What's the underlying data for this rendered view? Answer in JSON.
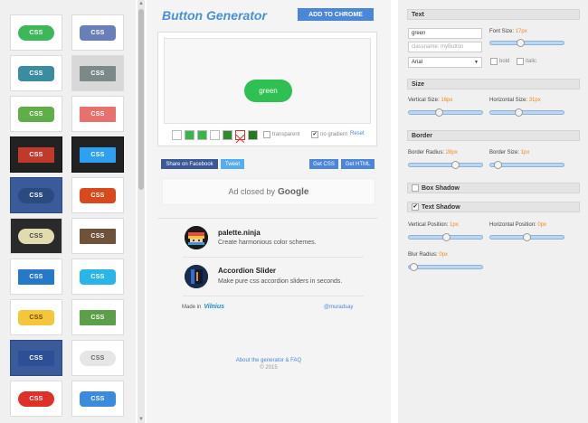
{
  "gallery": {
    "items": [
      {
        "label": "CSS",
        "color": "#3cb859",
        "shape": "pill",
        "bg": "plain"
      },
      {
        "label": "CSS",
        "color": "#6a7fba",
        "shape": "round",
        "bg": "plain"
      },
      {
        "label": "CSS",
        "color": "#3c8ca0",
        "shape": "round",
        "bg": "plain"
      },
      {
        "label": "CSS",
        "color": "#7b8a89",
        "shape": "flat",
        "bg": "grey"
      },
      {
        "label": "CSS",
        "color": "#5fae4a",
        "shape": "round",
        "bg": "plain"
      },
      {
        "label": "CSS",
        "color": "#e8716e",
        "shape": "flat",
        "bg": "plain"
      },
      {
        "label": "CSS",
        "color": "#c0392b",
        "shape": "flat",
        "bg": "dark"
      },
      {
        "label": "CSS",
        "color": "#2ea0f2",
        "shape": "flat",
        "bg": "dark"
      },
      {
        "label": "CSS",
        "color": "#2b4a80",
        "shape": "pill",
        "bg": "navy"
      },
      {
        "label": "CSS",
        "color": "#d84a1b",
        "shape": "round",
        "bg": "plain"
      },
      {
        "label": "CSS",
        "color": "#e0dcb0",
        "shape": "pill",
        "bg": "brownbg",
        "text": "#444"
      },
      {
        "label": "CSS",
        "color": "#6e5239",
        "shape": "flat",
        "bg": "plain"
      },
      {
        "label": "CSS",
        "color": "#2678c8",
        "shape": "flat",
        "bg": "plain"
      },
      {
        "label": "CSS",
        "color": "#2ab5e8",
        "shape": "round",
        "bg": "plain"
      },
      {
        "label": "CSS",
        "color": "#f5c53a",
        "shape": "round",
        "bg": "plain",
        "text": "#6a4a00"
      },
      {
        "label": "CSS",
        "color": "#5b9f48",
        "shape": "flat",
        "bg": "plain"
      },
      {
        "label": "CSS",
        "color": "#2c4f96",
        "shape": "flat",
        "bg": "navy"
      },
      {
        "label": "CSS",
        "color": "#e6e6e6",
        "shape": "pill",
        "bg": "plain",
        "text": "#666"
      },
      {
        "label": "CSS",
        "color": "#e0302a",
        "shape": "pill",
        "bg": "plain"
      },
      {
        "label": "CSS",
        "color": "#3a8be0",
        "shape": "round",
        "bg": "plain"
      }
    ]
  },
  "header": {
    "title": "Button Generator",
    "add_to_chrome": "ADD TO CHROME"
  },
  "preview": {
    "button_label": "green",
    "swatches": [
      "#ffffff",
      "#39b54a",
      "#39b54a",
      "#ffffff",
      "#2e8b2e",
      "#ffffff",
      "#227a22"
    ],
    "transparent_label": "transparent",
    "no_gradient_label": "no gradient",
    "reset_label": "Reset"
  },
  "share": {
    "facebook": "Share on Facebook",
    "tweet": "Tweet",
    "get_css": "Get CSS",
    "get_html": "Get HTML"
  },
  "ad": {
    "text": "Ad closed by",
    "brand": "Google"
  },
  "promos": [
    {
      "title": "palette.ninja",
      "desc": "Create harmonious color schemes."
    },
    {
      "title": "Accordion Slider",
      "desc": "Make pure css accordion sliders in seconds."
    }
  ],
  "footer": {
    "made_in": "Made in",
    "made_in_logo": "Vilnius",
    "handle": "@muradsay",
    "faq": "About the generator & FAQ",
    "copyright": "© 2015"
  },
  "settings": {
    "text": {
      "title": "Text",
      "value": "green",
      "classname_placeholder": "classname: myButton",
      "font": "Arial",
      "font_size_label": "Font Size:",
      "font_size_value": "17px",
      "font_size_level": 0.4,
      "bold": "bold",
      "italic": "italic"
    },
    "size": {
      "title": "Size",
      "vertical_label": "Vertical Size:",
      "vertical_value": "16px",
      "vertical_level": 0.4,
      "horizontal_label": "Horizontal Size:",
      "horizontal_value": "31px",
      "horizontal_level": 0.38
    },
    "border": {
      "title": "Border",
      "radius_label": "Border Radius:",
      "radius_value": "28px",
      "radius_level": 0.65,
      "size_label": "Border Size:",
      "size_value": "1px",
      "size_level": 0.05
    },
    "box_shadow": {
      "title": "Box Shadow",
      "checked": false
    },
    "text_shadow": {
      "title": "Text Shadow",
      "checked": true,
      "vertical_label": "Vertical Position:",
      "vertical_value": "1px",
      "vertical_level": 0.52,
      "horizontal_label": "Horizontal Position:",
      "horizontal_value": "0px",
      "horizontal_level": 0.5,
      "blur_label": "Blur Radius:",
      "blur_value": "0px",
      "blur_level": 0.02
    }
  }
}
